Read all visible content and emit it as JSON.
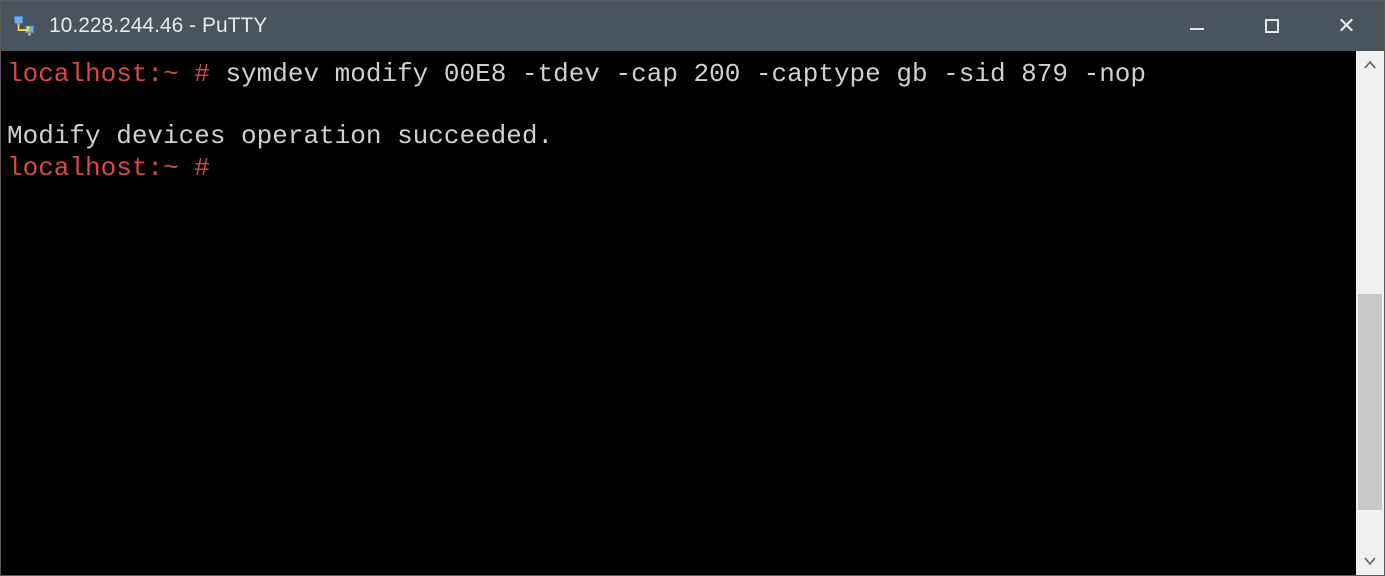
{
  "window": {
    "title": "10.228.244.46 - PuTTY"
  },
  "terminal": {
    "lines": [
      {
        "prompt": "localhost:~ #",
        "command": " symdev modify 00E8 -tdev -cap 200 -captype gb -sid 879 -nop"
      },
      {
        "blank": true
      },
      {
        "output": "Modify devices operation succeeded."
      },
      {
        "prompt": "localhost:~ #",
        "command": ""
      }
    ]
  },
  "controls": {
    "minimize_label": "Minimize",
    "maximize_label": "Maximize",
    "close_label": "Close"
  }
}
